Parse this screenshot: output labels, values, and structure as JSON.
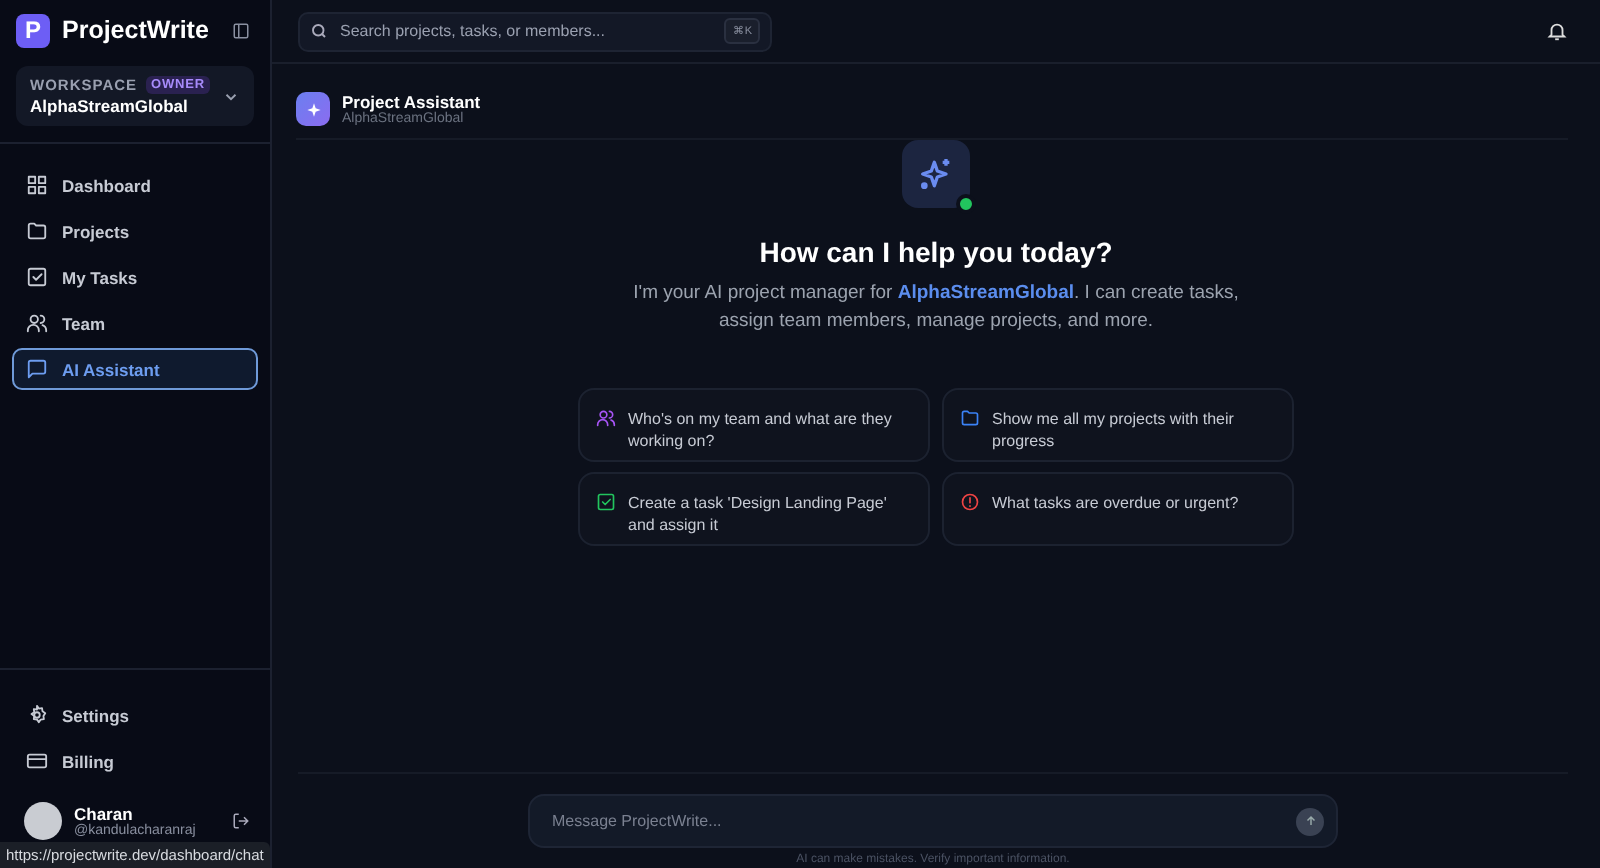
{
  "brand": {
    "logo_letter": "P",
    "name": "ProjectWrite"
  },
  "workspace": {
    "label": "WORKSPACE",
    "role": "OWNER",
    "name": "AlphaStreamGlobal"
  },
  "nav": [
    {
      "kind": "dashboard",
      "label": "Dashboard",
      "selected": false
    },
    {
      "kind": "projects",
      "label": "Projects",
      "selected": false
    },
    {
      "kind": "tasks",
      "label": "My Tasks",
      "selected": false
    },
    {
      "kind": "team",
      "label": "Team",
      "selected": false
    },
    {
      "kind": "chat",
      "label": "AI Assistant",
      "selected": true
    }
  ],
  "bottom_nav": [
    {
      "kind": "settings",
      "label": "Settings"
    },
    {
      "kind": "billing",
      "label": "Billing"
    }
  ],
  "user": {
    "name": "Charan",
    "handle": "@kandulacharanraj"
  },
  "status_bar": "https://projectwrite.dev/dashboard/chat",
  "search": {
    "placeholder": "Search projects, tasks, or members...",
    "shortcut": "⌘K"
  },
  "chat_header": {
    "title": "Project Assistant",
    "subtitle": "AlphaStreamGlobal"
  },
  "hero": {
    "online": true,
    "title": "How can I help you today?",
    "text": "I'm your AI project manager for **AlphaStreamGlobal**. I can create tasks, assign team members, manage projects, and more."
  },
  "suggestions": [
    {
      "kind": "team",
      "color": "#a855f7",
      "text": "Who's on my team and what are they working on?"
    },
    {
      "kind": "folder",
      "color": "#3b82f6",
      "text": "Show me all my projects with their progress"
    },
    {
      "kind": "check",
      "color": "#22c55e",
      "text": "Create a task 'Design Landing Page' and assign it"
    },
    {
      "kind": "alert",
      "color": "#ef4444",
      "text": "What tasks are overdue or urgent?"
    }
  ],
  "composer": {
    "placeholder": "Message ProjectWrite...",
    "disclaimer": "AI can make mistakes. Verify important information."
  }
}
